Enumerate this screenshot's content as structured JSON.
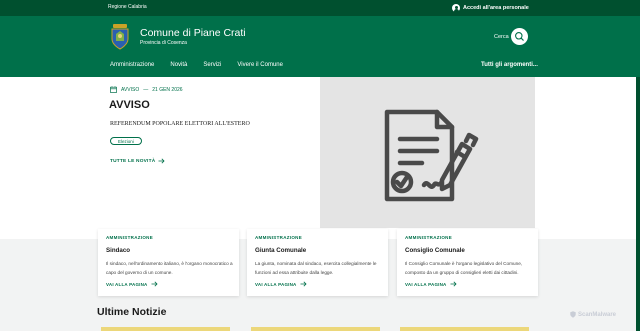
{
  "topbar": {
    "region": "Regione Calabria",
    "login_label": "Accedi all'area personale"
  },
  "header": {
    "title": "Comune di Piane Crati",
    "subtitle": "Provincia di Cosenza",
    "search_label": "Cerca",
    "nav": [
      "Amministrazione",
      "Novità",
      "Servizi",
      "Vivere il Comune"
    ],
    "nav_right": "Tutti gli argomenti..."
  },
  "hero": {
    "category": "AVVISO",
    "date": "21 GEN 2026",
    "title": "AVVISO",
    "description": "REFERENDUM POPOLARE ELETTORI ALL'ESTERO",
    "tag": "Elezioni",
    "all_news_label": "TUTTE LE NOVITÀ"
  },
  "cards": [
    {
      "category": "AMMINISTRAZIONE",
      "title": "Sindaco",
      "description": "Il sindaco, nell'ordinamento italiano, è l'organo monocratico a capo del governo di un comune.",
      "link": "VAI ALLA PAGINA"
    },
    {
      "category": "AMMINISTRAZIONE",
      "title": "Giunta Comunale",
      "description": "La giunta, nominata dal sindaco, esercita collegialmente le funzioni ad essa attribuite dalla legge.",
      "link": "VAI ALLA PAGINA"
    },
    {
      "category": "AMMINISTRAZIONE",
      "title": "Consiglio Comunale",
      "description": "Il Consiglio Comunale è l'organo legislativo del Comune, composto da un gruppo di consiglieri eletti dai cittadini.",
      "link": "VAI ALLA PAGINA"
    }
  ],
  "news": {
    "heading": "Ultime Notizie"
  },
  "watermark": "ScanMalware",
  "colors": {
    "topbar": "#00502f",
    "header": "#00704a",
    "accent": "#00704a",
    "hero_image_bg": "#e4e4e4",
    "news_thumb": "#ecd77a"
  },
  "icons": {
    "login": "user-circle-icon",
    "search": "search-icon",
    "calendar": "calendar-icon",
    "arrow": "arrow-right-icon",
    "hero": "signed-document-icon",
    "crest": "municipal-crest-icon"
  }
}
